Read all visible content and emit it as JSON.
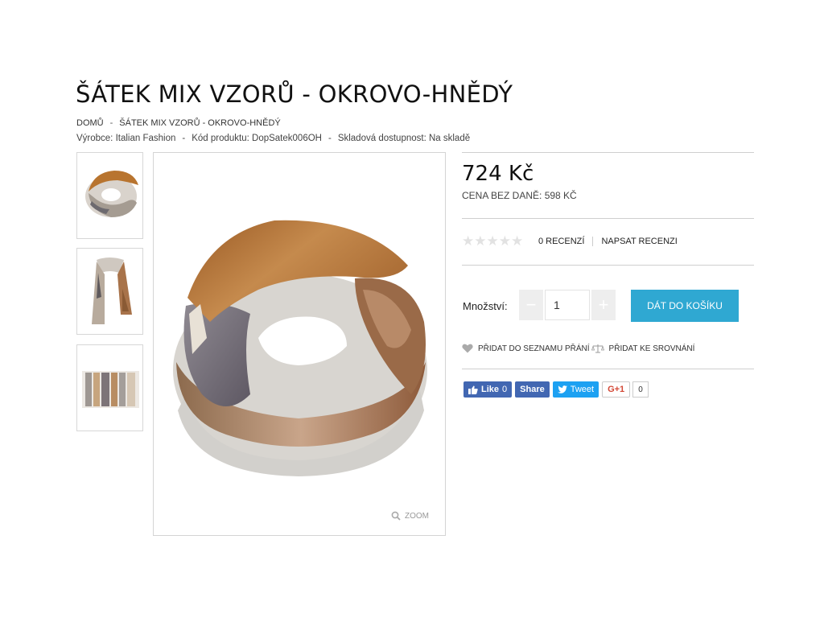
{
  "product": {
    "title": "ŠÁTEK MIX VZORŮ - OKROVO-HNĚDÝ"
  },
  "breadcrumb": {
    "home": "DOMŮ",
    "separator": "-",
    "current": "ŠÁTEK MIX VZORŮ - OKROVO-HNĚDÝ"
  },
  "meta": {
    "manufacturer": "Výrobce: Italian Fashion",
    "code": "Kód produktu: DopSatek006OH",
    "availability": "Skladová dostupnost: Na skladě",
    "separator": "-"
  },
  "gallery": {
    "zoom_label": "ZOOM",
    "thumbnails": [
      "scarf-ring",
      "scarf-hanging",
      "scarf-folded"
    ]
  },
  "price": {
    "main": "724 Kč",
    "net": "CENA BEZ DANĚ: 598 KČ"
  },
  "rating": {
    "stars": 0,
    "max": 5,
    "reviews": "0 RECENZÍ",
    "write_review": "NAPSAT RECENZI"
  },
  "cart": {
    "qty_label": "Množství:",
    "qty_value": "1",
    "minus": "−",
    "plus": "+",
    "add_button": "DÁT DO KOŠÍKU"
  },
  "actions": {
    "wishlist": "PŘIDAT DO SEZNAMU PŘÁNÍ",
    "compare": "PŘIDAT KE SROVNÁNÍ"
  },
  "social": {
    "fb_like": "Like",
    "fb_like_count": "0",
    "fb_share": "Share",
    "tweet": "Tweet",
    "gplus": "G+1",
    "gplus_count": "0"
  },
  "colors": {
    "accent": "#2fa8d2",
    "facebook": "#4267b2",
    "twitter": "#1da1f2"
  }
}
